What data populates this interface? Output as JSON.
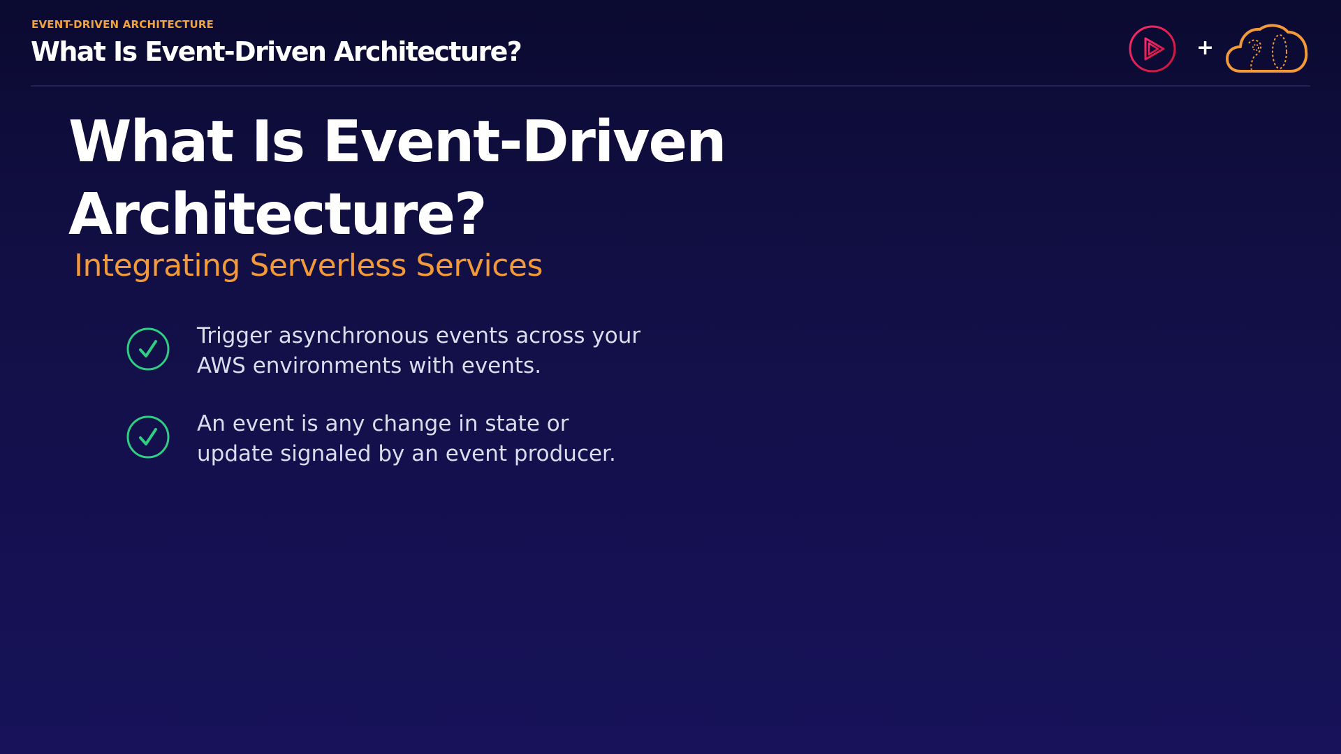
{
  "header": {
    "eyebrow": "EVENT-DRIVEN ARCHITECTURE",
    "title": "What Is Event-Driven Architecture?",
    "plus": "+"
  },
  "main": {
    "title_line1": "What Is Event-Driven",
    "title_line2": "Architecture?",
    "subtitle": "Integrating Serverless Services"
  },
  "bullets": [
    {
      "line1": "Trigger asynchronous events across your",
      "line2": "AWS environments with events."
    },
    {
      "line1": "An event is any change in state or",
      "line2": "update signaled by an event producer."
    }
  ],
  "colors": {
    "accent_orange": "#f29a3a",
    "check_green": "#2ecf82",
    "play_red": "#e1274f",
    "background": "#120f45"
  },
  "icons": {
    "play": "play-circle-icon",
    "cloud": "cloud-icon",
    "check": "checkmark-circle-icon"
  }
}
